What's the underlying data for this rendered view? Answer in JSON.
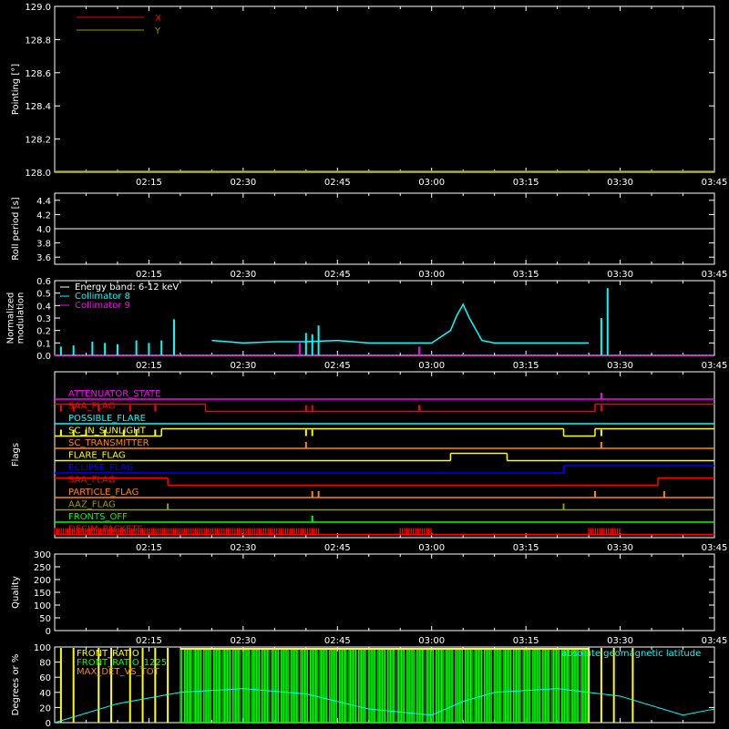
{
  "time_ticks": [
    "02:15",
    "02:30",
    "02:45",
    "03:00",
    "03:15",
    "03:30",
    "03:45"
  ],
  "x_range": [
    "02:00",
    "03:45"
  ],
  "colors": {
    "background": "#000000",
    "axes": "#ffffff",
    "red": "#ff0000",
    "olive": "#999900",
    "cyan": "#00ffff",
    "magenta": "#ff00ff",
    "yellow": "#ffff00",
    "orange": "#ff8800",
    "blue": "#0000ff",
    "green": "#00ff00"
  },
  "chart_data": [
    {
      "id": "pointing",
      "type": "line",
      "ylabel": "Pointing [°]",
      "ylim": [
        128.0,
        129.0
      ],
      "yticks": [
        "128.0",
        "128.2",
        "128.4",
        "128.6",
        "128.8",
        "129.0"
      ],
      "legend_position": "top-left",
      "series": [
        {
          "name": "X",
          "color": "#ff0000",
          "x": [],
          "y": []
        },
        {
          "name": "Y",
          "color": "#999900",
          "x": [
            "02:00",
            "03:45"
          ],
          "y": [
            128.0,
            128.0
          ]
        }
      ]
    },
    {
      "id": "roll",
      "type": "line",
      "ylabel": "Roll period [s]",
      "ylim": [
        3.5,
        4.5
      ],
      "yticks": [
        "3.6",
        "3.8",
        "4.0",
        "4.2",
        "4.4"
      ],
      "series": [
        {
          "color": "#ffffff",
          "x": [
            "02:00",
            "03:45"
          ],
          "y": [
            4.0,
            4.0
          ]
        }
      ]
    },
    {
      "id": "modulation",
      "type": "line",
      "ylabel": "Normalized modulation",
      "ylim": [
        0.0,
        0.6
      ],
      "yticks": [
        "0.0",
        "0.1",
        "0.2",
        "0.3",
        "0.4",
        "0.5",
        "0.6"
      ],
      "legend_position": "top-left",
      "energy_band": "Energy band: 6-12 keV",
      "series": [
        {
          "name": "Collimator 8",
          "color": "#00ffff",
          "x": [
            "02:25",
            "02:30",
            "02:35",
            "02:40",
            "02:45",
            "02:50",
            "02:55",
            "03:00",
            "03:03",
            "03:04",
            "03:05",
            "03:06",
            "03:08",
            "03:10",
            "03:15",
            "03:20",
            "03:25"
          ],
          "y": [
            0.12,
            0.1,
            0.11,
            0.11,
            0.12,
            0.1,
            0.1,
            0.1,
            0.2,
            0.32,
            0.41,
            0.3,
            0.12,
            0.1,
            0.1,
            0.1,
            0.1
          ],
          "spikes": [
            [
              "02:01",
              0.07
            ],
            [
              "02:03",
              0.08
            ],
            [
              "02:06",
              0.11
            ],
            [
              "02:08",
              0.1
            ],
            [
              "02:10",
              0.09
            ],
            [
              "02:13",
              0.12
            ],
            [
              "02:15",
              0.1
            ],
            [
              "02:17",
              0.12
            ],
            [
              "02:19",
              0.29
            ],
            [
              "02:40",
              0.18
            ],
            [
              "02:41",
              0.17
            ],
            [
              "02:42",
              0.24
            ],
            [
              "03:27",
              0.3
            ],
            [
              "03:28",
              0.54
            ]
          ]
        },
        {
          "name": "Collimator 9",
          "color": "#ff00ff",
          "x": [
            "02:00",
            "03:45"
          ],
          "y": [
            0.0,
            0.0
          ],
          "spikes": [
            [
              "02:39",
              0.1
            ],
            [
              "02:58",
              0.07
            ]
          ]
        }
      ]
    },
    {
      "id": "flags",
      "type": "line",
      "ylabel": "Flags",
      "flags": [
        {
          "label": "ATTENUATOR_STATE",
          "color": "#ff00ff",
          "segments": [
            [
              "02:00",
              "03:45",
              0
            ]
          ],
          "spikes": [
            "03:27"
          ]
        },
        {
          "label": "SAA_FLAG",
          "color": "#ff0000",
          "segments": [
            [
              "02:00",
              "02:24",
              1
            ],
            [
              "02:24",
              "03:26",
              0
            ],
            [
              "03:26",
              "03:45",
              1
            ]
          ],
          "spikes": [
            "02:01",
            "02:03",
            "02:07",
            "02:12",
            "02:16",
            "02:40",
            "02:41",
            "02:58",
            "03:27"
          ]
        },
        {
          "label": "POSSIBLE_FLARE",
          "color": "#00ffff",
          "segments": [
            [
              "02:00",
              "03:45",
              0
            ]
          ],
          "spikes": []
        },
        {
          "label": "SC_IN_SUNLIGHT",
          "color": "#ffff00",
          "segments": [
            [
              "02:00",
              "02:17",
              0
            ],
            [
              "02:17",
              "03:21",
              1
            ],
            [
              "03:21",
              "03:26",
              0
            ],
            [
              "03:26",
              "03:45",
              1
            ]
          ],
          "spikes": [
            "02:01",
            "02:03",
            "02:05",
            "02:08",
            "02:11",
            "02:13",
            "02:16",
            "02:40",
            "02:41",
            "03:27"
          ]
        },
        {
          "label": "SC_TRANSMITTER",
          "color": "#ff8800",
          "segments": [
            [
              "02:00",
              "03:45",
              0
            ]
          ],
          "spikes": [
            "02:40",
            "03:27"
          ]
        },
        {
          "label": "FLARE_FLAG",
          "color": "#ffff00",
          "segments": [
            [
              "02:00",
              "03:03",
              0
            ],
            [
              "03:03",
              "03:12",
              1
            ],
            [
              "03:12",
              "03:45",
              0
            ]
          ],
          "spikes": []
        },
        {
          "label": "ECLIPSE_FLAG",
          "color": "#0000ff",
          "segments": [
            [
              "02:00",
              "03:21",
              0
            ],
            [
              "03:21",
              "03:45",
              1
            ]
          ],
          "spikes": []
        },
        {
          "label": "SAA_FLAG",
          "color": "#ff0000",
          "segments": [
            [
              "02:00",
              "02:18",
              1
            ],
            [
              "02:18",
              "03:36",
              0
            ],
            [
              "03:36",
              "03:45",
              1
            ]
          ],
          "spikes": []
        },
        {
          "label": "PARTICLE_FLAG",
          "color": "#ff8800",
          "segments": [
            [
              "02:00",
              "03:45",
              0
            ]
          ],
          "spikes": [
            "02:41",
            "02:42",
            "03:26",
            "03:37"
          ]
        },
        {
          "label": "AAZ_FLAG",
          "color": "#999900",
          "segments": [
            [
              "02:00",
              "03:45",
              0
            ]
          ],
          "spikes": [
            "02:18",
            "03:21"
          ]
        },
        {
          "label": "FRONTS_OFF",
          "color": "#00ff00",
          "segments": [
            [
              "02:00",
              "03:45",
              0
            ]
          ],
          "spikes": [
            "02:41"
          ]
        },
        {
          "label": "DECIM_PACKETS",
          "color": "#ff0000",
          "segments": [
            [
              "02:00",
              "03:45",
              0
            ]
          ],
          "dense": [
            [
              "02:00",
              "02:42"
            ],
            [
              "02:55",
              "03:00"
            ],
            [
              "03:25",
              "03:30"
            ]
          ]
        }
      ]
    },
    {
      "id": "quality",
      "type": "line",
      "ylabel": "Quality",
      "ylim": [
        0,
        300
      ],
      "yticks": [
        "0",
        "50",
        "100",
        "150",
        "200",
        "250",
        "300"
      ],
      "series": [
        {
          "color": "#ffffff",
          "x": [
            "02:00",
            "03:45"
          ],
          "y": [
            300,
            300
          ]
        }
      ]
    },
    {
      "id": "fronts",
      "type": "line",
      "ylabel": "Degrees or %",
      "ylim": [
        0,
        100
      ],
      "yticks": [
        "0",
        "20",
        "40",
        "60",
        "80",
        "100"
      ],
      "legend_position": "top",
      "series": [
        {
          "name": "FRONT_RATIO",
          "color": "#ffff00",
          "spikes": [
            "02:01",
            "02:03",
            "02:07",
            "02:09",
            "02:12",
            "02:14",
            "02:16",
            "02:18",
            "03:25",
            "03:27",
            "03:29",
            "03:32"
          ]
        },
        {
          "name": "FRONT_RATIO_1225",
          "color": "#00ff00",
          "dense": [
            [
              "02:20",
              "03:25"
            ]
          ]
        },
        {
          "name": "MAX_DET_VS_TOT",
          "color": "#ff8800",
          "x": [],
          "y": []
        },
        {
          "name": "absolute geomagnetic latitude",
          "color": "#00ffff",
          "x": [
            "02:00",
            "02:10",
            "02:20",
            "02:30",
            "02:40",
            "02:50",
            "03:00",
            "03:05",
            "03:10",
            "03:20",
            "03:30",
            "03:40",
            "03:45"
          ],
          "y": [
            0,
            25,
            40,
            45,
            38,
            18,
            10,
            28,
            40,
            45,
            35,
            10,
            18
          ]
        }
      ]
    }
  ]
}
